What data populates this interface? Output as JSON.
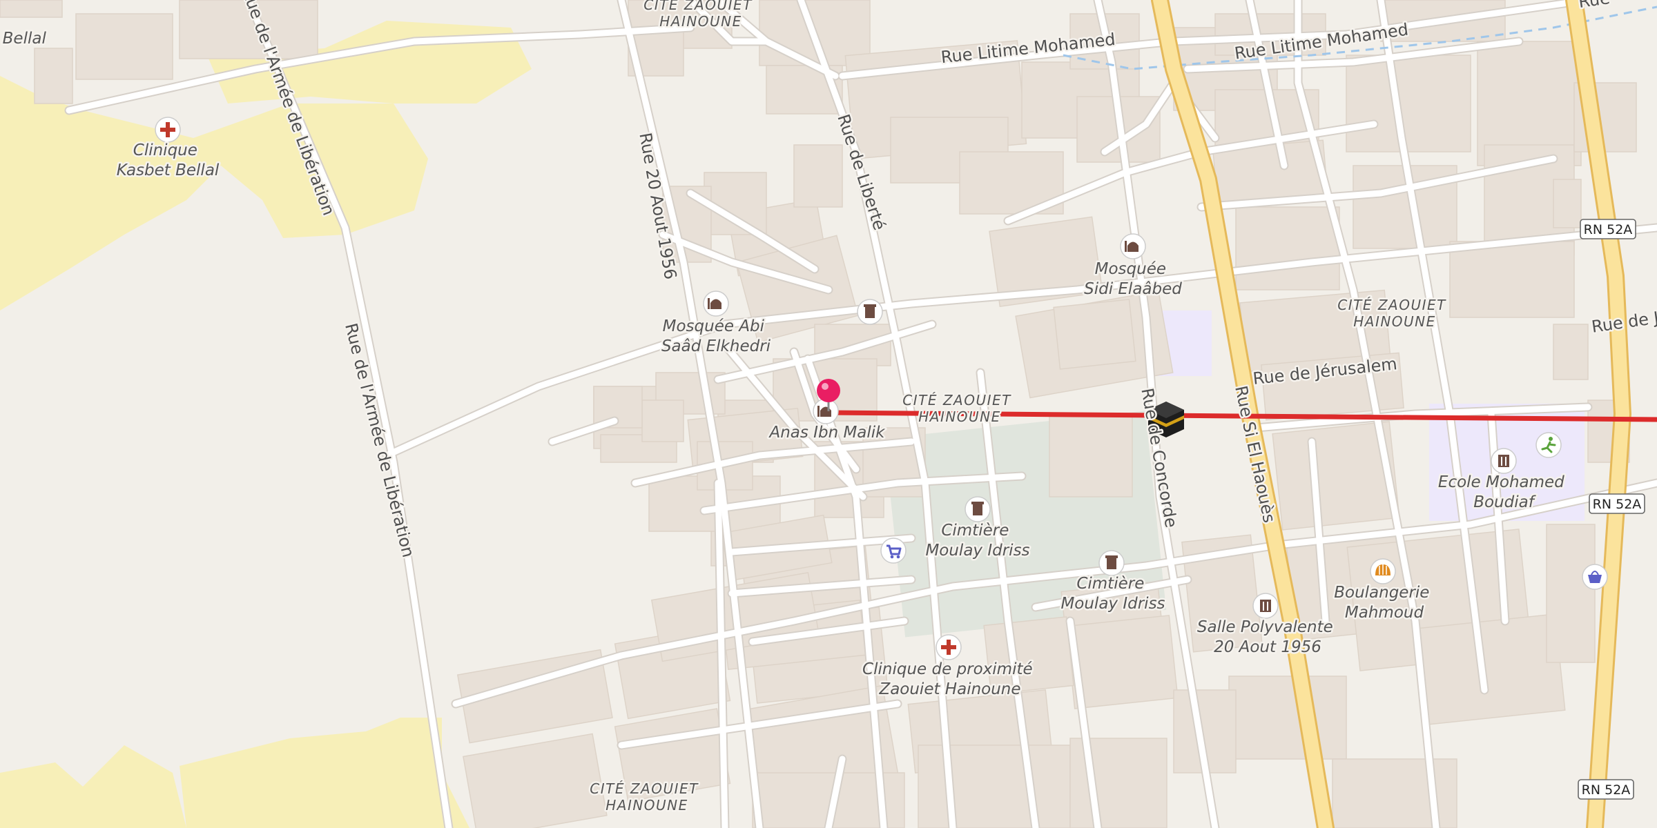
{
  "map": {
    "labels": {
      "clinique_kasbet": [
        "Clinique",
        "Kasbet Bellal"
      ],
      "kasbet_partial": "et Bellal",
      "cite_top": [
        "CITÉ ZAOUIET",
        "HAINOUNE"
      ],
      "cite_center": [
        "CITÉ ZAOUIET",
        "HAINOUNE"
      ],
      "cite_right": [
        "CITÉ ZAOUIET",
        "HAINOUNE"
      ],
      "cite_bottom": [
        "CITÉ ZAOUIET",
        "HAINOUNE"
      ],
      "mosquee_abi": [
        "Mosquée Abi",
        "Saâd Elkhedri"
      ],
      "mosquee_sidi": [
        "Mosquée",
        "Sidi Elaâbed"
      ],
      "anas": "Anas Ibn Malik",
      "cimetiere_1": [
        "Cimtière",
        "Moulay Idriss"
      ],
      "cimetiere_2": [
        "Cimtière",
        "Moulay Idriss"
      ],
      "clinique_proximite": [
        "Clinique de proximité",
        "Zaouiet Hainoune"
      ],
      "salle": [
        "Salle Polyvalente",
        "20 Aout 1956"
      ],
      "boulangerie": [
        "Boulangerie",
        "Mahmoud"
      ],
      "ecole": [
        "Ecole Mohamed",
        "Boudiaf"
      ]
    },
    "streets": {
      "armee_top": "Rue de l'Armée de Libération",
      "armee_bottom": "Rue de l'Armée de Libération",
      "aout": "Rue 20 Aout 1956",
      "liberte": "Rue de Liberté",
      "litime_1": "Rue Litime Mohamed",
      "litime_2": "Rue Litime Mohamed",
      "jerusalem": "Rue de Jérusalem",
      "concorde": "Rue de Concorde",
      "si_el_haoues": "Rue Si El Haouès",
      "rue_de_partial": "Rue de J",
      "rue_top_partial": "Rue"
    },
    "shields": [
      "RN 52A",
      "RN 52A",
      "RN 52A"
    ],
    "icons": [
      "hospital-icon",
      "mosque-icon",
      "cemetery-icon",
      "shopping-cart-icon",
      "bakery-icon",
      "school-icon",
      "sports-icon",
      "shopping-bag-icon",
      "kaaba-icon",
      "location-pin-icon"
    ],
    "colors": {
      "land": "#f2efe9",
      "building": "#e8e0d7",
      "road": "#ffffff",
      "main_road": "#fbe39c",
      "main_road_border": "#e5b95a",
      "farmland": "#f7efb8",
      "cemetery": "#e0e5dd",
      "school": "#ede8fb",
      "route": "#dc2b2b",
      "pin": "#e91e63",
      "hospital": "#c0392b"
    }
  }
}
